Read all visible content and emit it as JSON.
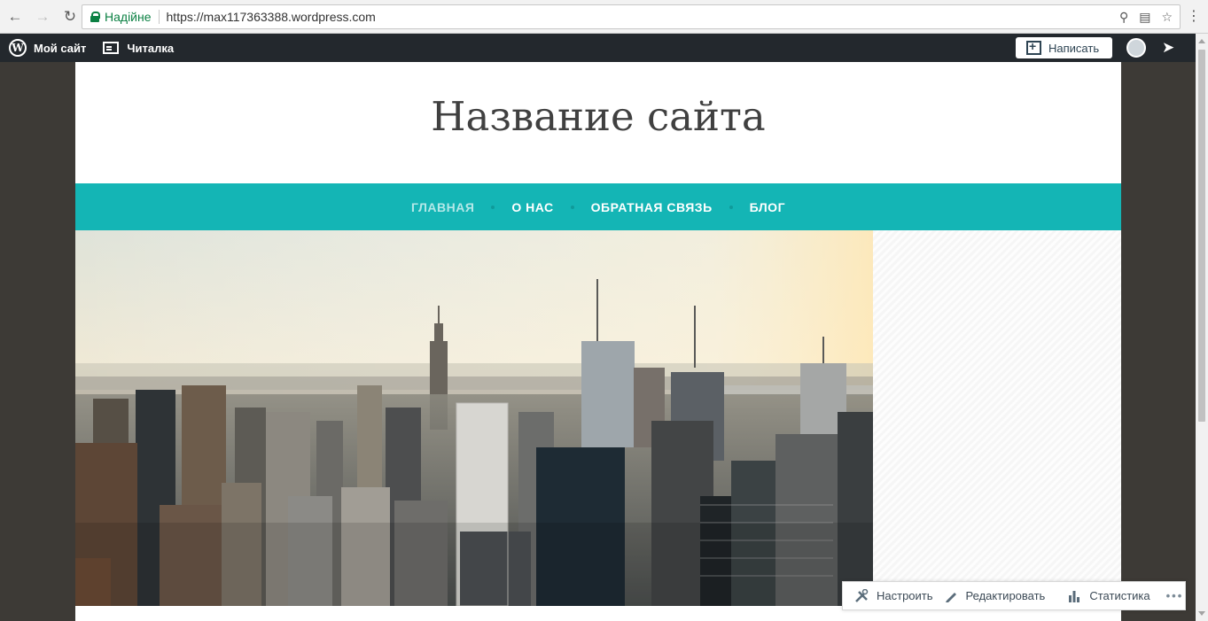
{
  "browser": {
    "secure_label": "Надійне",
    "url": "https://max117363388.wordpress.com",
    "icons": [
      "back-icon",
      "forward-icon",
      "reload-icon",
      "key-icon",
      "translate-icon",
      "star-icon",
      "menu-icon"
    ]
  },
  "adminbar": {
    "my_site": "Мой сайт",
    "reader": "Читалка",
    "write": "Написать"
  },
  "site": {
    "title": "Название сайта"
  },
  "nav": {
    "items": [
      "ГЛАВНАЯ",
      "О НАС",
      "ОБРАТНАЯ СВЯЗЬ",
      "БЛОГ"
    ],
    "active": "ГЛАВНАЯ"
  },
  "toolbar": {
    "customize": "Настроить",
    "edit": "Редактировать",
    "stats": "Статистика",
    "more": "•••"
  },
  "colors": {
    "nav": "#14b5b5",
    "adminbar": "#23282d",
    "secure": "#0b8043"
  }
}
